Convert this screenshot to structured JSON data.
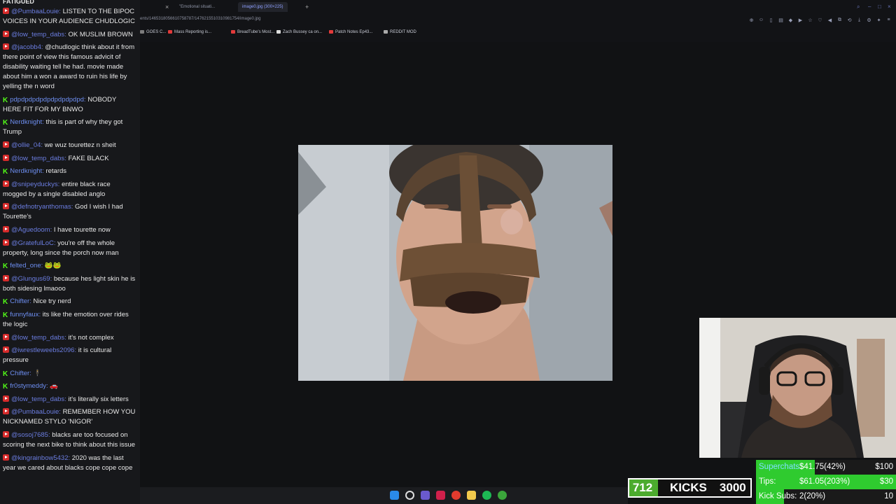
{
  "chat": {
    "header": "FATIGUED",
    "messages": [
      {
        "platform": "yt",
        "user": "@PumbaaLouie",
        "text": "LISTEN TO THE BIPOC VOICES IN YOUR AUDIENCE CHUDLOGIC"
      },
      {
        "platform": "yt",
        "user": "@low_temp_dabs",
        "text": "OK MUSLIM BROWN"
      },
      {
        "platform": "yt",
        "user": "@jacobb4",
        "text": "@chudlogic think about it from there point of view this famous advicit of disability waiting tell he had. movie made about him a won a award to ruin his life by yelling the n word"
      },
      {
        "platform": "kick",
        "user": "pdpdpdpdpdpdpdpdpdpd",
        "text": "NOBODY HERE FIT FOR MY BNWO"
      },
      {
        "platform": "kick",
        "user": "Nerdknight",
        "text": "this is part of why they got Trump"
      },
      {
        "platform": "yt",
        "user": "@ollie_04",
        "text": "we wuz tourettez n sheit"
      },
      {
        "platform": "yt",
        "user": "@low_temp_dabs",
        "text": "FAKE BLACK"
      },
      {
        "platform": "kick",
        "user": "Nerdknight",
        "text": "retards"
      },
      {
        "platform": "yt",
        "user": "@snipeyduckys",
        "text": "entire black race mogged by a single disabled anglo"
      },
      {
        "platform": "yt",
        "user": "@defnotryanthomas",
        "text": "God I wish I had Tourette's"
      },
      {
        "platform": "yt",
        "user": "@Aguedoom",
        "text": "I have tourette now"
      },
      {
        "platform": "yt",
        "user": "@GratefulLoC",
        "text": "you're off the whole property, long since the porch now man"
      },
      {
        "platform": "kick",
        "user": "felted_one",
        "text": "🐸🐸"
      },
      {
        "platform": "yt",
        "user": "@Glungus69",
        "text": "because hes light skin he is both sidesing lmaooo"
      },
      {
        "platform": "kick",
        "user": "Chifter",
        "text": "Nice try nerd"
      },
      {
        "platform": "kick",
        "user": "funnyfaux",
        "text": "its like the emotion over rides the logic"
      },
      {
        "platform": "yt",
        "user": "@low_temp_dabs",
        "text": "it's not complex"
      },
      {
        "platform": "yt",
        "user": "@iwrestleweebs2096",
        "text": "it is cultural pressure"
      },
      {
        "platform": "kick",
        "user": "Chifter",
        "text": "🕴"
      },
      {
        "platform": "kick",
        "user": "fr0stymeddy",
        "text": "🚗"
      },
      {
        "platform": "yt",
        "user": "@low_temp_dabs",
        "text": "it's literally six letters"
      },
      {
        "platform": "yt",
        "user": "@PumbaaLouie",
        "text": "REMEMBER HOW YOU NICKNAMED STYLO 'NIGOR'"
      },
      {
        "platform": "yt",
        "user": "@sosoj7685",
        "text": "blacks are too focused on scoring the next bike to think about this issue"
      },
      {
        "platform": "yt",
        "user": "@kingrainbow5432",
        "text": "2020 was the last year we cared about blacks cope cope cope"
      }
    ]
  },
  "browser": {
    "tabs": [
      "\"Emotional situati...",
      "image0.jpg (300×225)"
    ],
    "url": "ents/1465318056610758787/1476215510310981754/image0.jpg",
    "bookmarks": [
      "GOES C...",
      "Mass Reporting is...",
      "BreadTube's Most...",
      "Zach Bussey ca on...",
      "Patch Notes Ep43...",
      "REDDIT MOD"
    ],
    "bookmark_colors": [
      "#7c7c7c",
      "#e23a3a",
      "#e23a3a",
      "#dddddd",
      "#e23a3a",
      "#aaaaaa"
    ]
  },
  "kicks": {
    "count": "712",
    "label": "KICKS",
    "goal": "3000",
    "progress": 0.237
  },
  "goals": [
    {
      "label": "Superchats:",
      "value": "$41.75(42%)",
      "target": "$100",
      "progress": 0.42
    },
    {
      "label": "Tips:",
      "value": "$61.05(203%)",
      "target": "$30",
      "progress": 1.0
    },
    {
      "label": "Kick Subs:",
      "value": "2(20%)",
      "target": "10",
      "progress": 0.2
    }
  ]
}
